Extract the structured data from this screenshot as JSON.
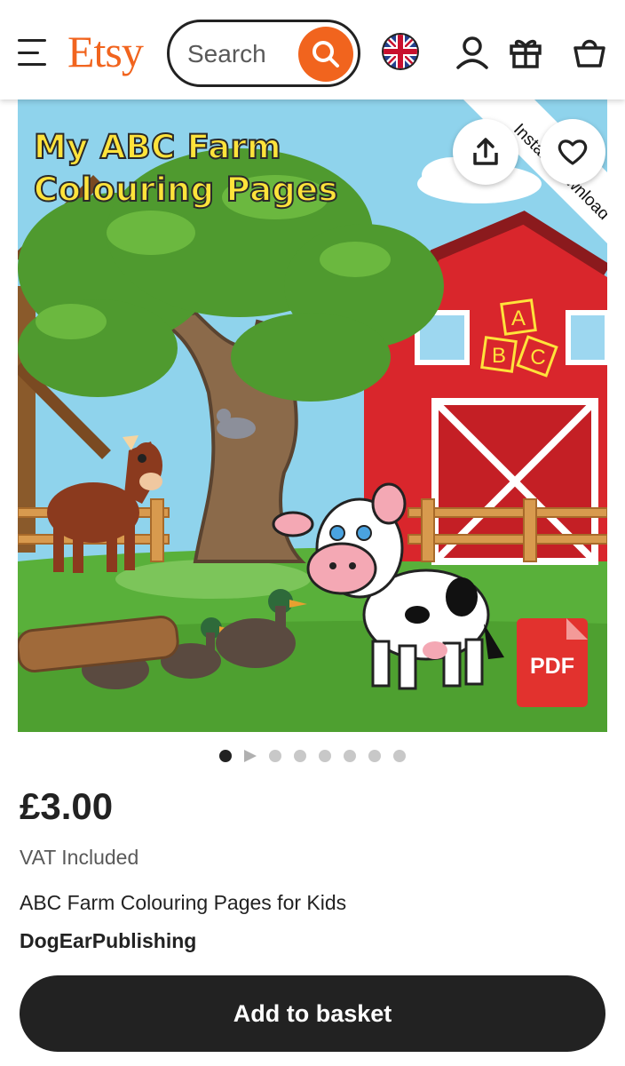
{
  "header": {
    "logo": "Etsy",
    "search_placeholder": "Search"
  },
  "listing_image": {
    "title_line1": "My ABC Farm",
    "title_line2": "Colouring Pages",
    "ribbon_text": "Instant download",
    "blocks": [
      "A",
      "B",
      "C"
    ],
    "pdf_label": "PDF",
    "dots_total": 8,
    "dots_active": 1
  },
  "listing": {
    "price": "£3.00",
    "vat": "VAT Included",
    "title": "ABC Farm Colouring Pages for Kids",
    "shop": "DogEarPublishing",
    "add_to_basket": "Add to basket"
  },
  "colors": {
    "brand": "#f1641e",
    "primary_button": "#222222",
    "barn_red": "#d9262c",
    "title_yellow": "#ffe33b"
  }
}
